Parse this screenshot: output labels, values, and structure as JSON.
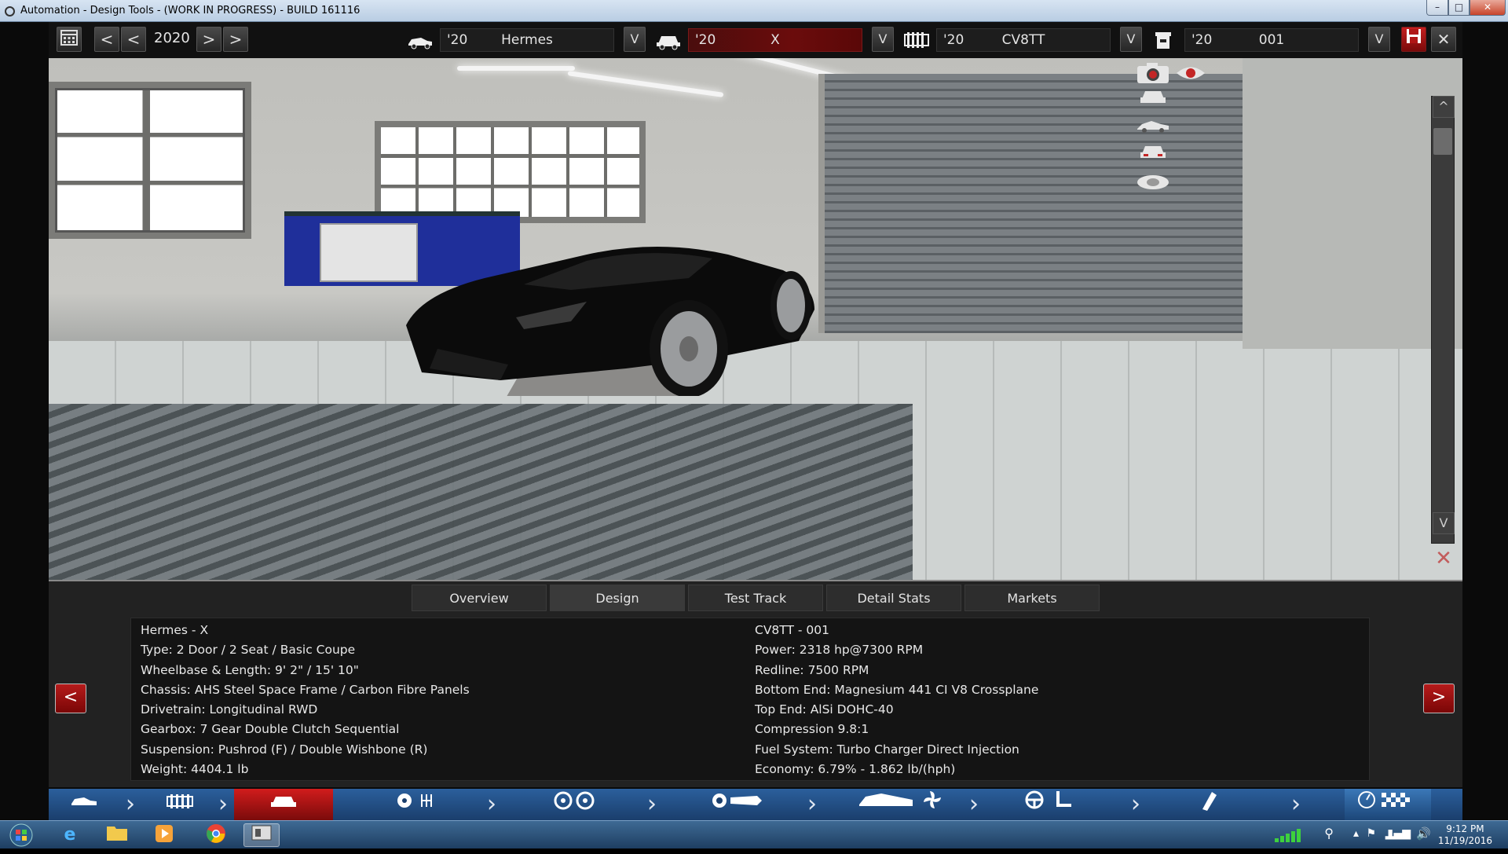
{
  "window": {
    "title": "Automation - Design Tools - (WORK IN PROGRESS) - BUILD 161116",
    "min_label": "–",
    "max_label": "□",
    "close_label": "✕"
  },
  "toolbar": {
    "calendar_icon": "calendar-icon",
    "year": "2020",
    "prev_far": "<",
    "prev": "<",
    "next": ">",
    "next_far": ">",
    "selectors": [
      {
        "icon": "car-model-icon",
        "year": "'20",
        "name": "Hermes",
        "dropdown": "V"
      },
      {
        "icon": "car-trim-icon",
        "year": "'20",
        "name": "X",
        "dropdown": "V"
      },
      {
        "icon": "engine-family-icon",
        "year": "'20",
        "name": "CV8TT",
        "dropdown": "V"
      },
      {
        "icon": "engine-variant-icon",
        "year": "'20",
        "name": "001",
        "dropdown": "V"
      }
    ],
    "save_icon": "save-icon",
    "close_label": "✕"
  },
  "viewport": {
    "scroll_up": "^",
    "scroll_down": "V"
  },
  "tabs": [
    "Overview",
    "Design",
    "Test Track",
    "Detail Stats",
    "Markets"
  ],
  "active_tab": "Design",
  "car_info": [
    "Hermes - X",
    "Type: 2 Door / 2 Seat / Basic Coupe",
    "Wheelbase & Length: 9' 2\" / 15' 10\"",
    "Chassis: AHS Steel Space Frame / Carbon Fibre Panels",
    "Drivetrain: Longitudinal RWD",
    "Gearbox: 7 Gear Double Clutch Sequential",
    "Suspension: Pushrod (F) / Double Wishbone (R)",
    "Weight: 4404.1 lb"
  ],
  "engine_info": [
    "CV8TT - 001",
    "Power: 2318 hp@7300 RPM",
    "Redline: 7500 RPM",
    "Bottom End: Magnesium 441 CI V8 Crossplane",
    "Top End: AlSi DOHC-40",
    "Compression 9.8:1",
    "Fuel System: Turbo Charger Direct Injection",
    "Economy: 6.79% - 1.862 lb/(hph)"
  ],
  "panel": {
    "left_arrow": "<",
    "right_arrow": ">"
  },
  "steps": [
    "car-model-icon",
    "engine-icon",
    "car-trim-icon",
    "gearbox-icon",
    "wheels-icon",
    "brakes-icon",
    "body-cooling-icon",
    "interior-icon",
    "fuel-icon",
    "test-track-icon"
  ],
  "taskbar": {
    "time": "9:12 PM",
    "date": "11/19/2016"
  }
}
